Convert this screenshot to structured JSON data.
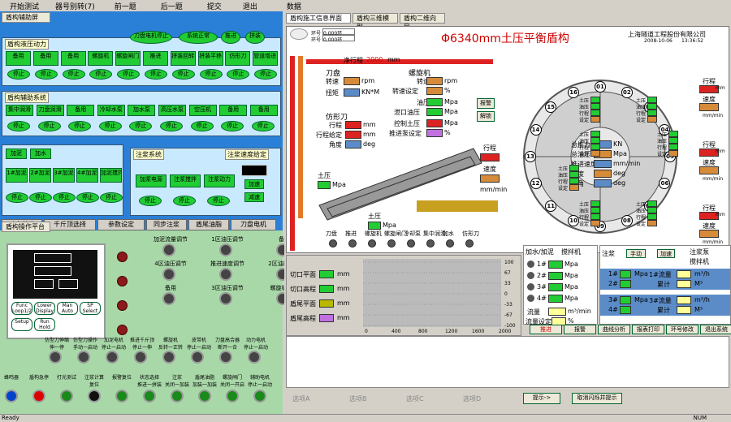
{
  "menu": [
    "开始测试",
    "器号别转(7)",
    "前一题",
    "后一题",
    "提交",
    "退出",
    "数据"
  ],
  "left": {
    "tab": "盾构辅助屏",
    "hydro": {
      "title": "盾构液压动力",
      "r1": [
        "备用",
        "备用",
        "备用",
        "螺旋机",
        "螺旋闸门\n高合器",
        "推进",
        "拼装回转",
        "拼装平移",
        "仿形刀",
        "管道增进\n吸引器"
      ],
      "r2": [
        "停止",
        "停止",
        "停止",
        "停止",
        "停止",
        "停止",
        "停止",
        "停止",
        "停止",
        "停止"
      ],
      "top": [
        "刀盘电机停止",
        "系统正常",
        "推进",
        "拼装"
      ]
    },
    "aux": {
      "title": "盾构辅助系统",
      "r1": [
        "集中润滑",
        "刀盘润滑",
        "备用",
        "冷却水泵",
        "加水泵",
        "高压水泵",
        "空压机",
        "备用",
        "备用"
      ],
      "r2": [
        "停止",
        "停止",
        "停止",
        "停止",
        "停止",
        "停止",
        "停止",
        "停止",
        "停止"
      ]
    },
    "mud": {
      "r0": [
        "加泥",
        "加水"
      ],
      "r1": [
        "1#加泥",
        "2#加泥",
        "3#加泥",
        "4#加泥\n加水",
        "加泥搅拌"
      ],
      "r2": [
        "停止",
        "停止",
        "停止",
        "停止",
        "停止"
      ]
    },
    "grout": {
      "title": "注浆系统",
      "r1": [
        "加浆电源",
        "注浆搅拌",
        "注浆动力"
      ],
      "r2": [
        "停止",
        "停止",
        "停止"
      ],
      "rate_title": "注浆速度给定",
      "up": "加速",
      "down": "减速"
    },
    "bottom": [
      "动力单元",
      "千斤顶选择",
      "参数设定",
      "同步注浆",
      "盾尾油脂",
      "刀盘电机"
    ]
  },
  "ops": {
    "tab": "盾构操作平台",
    "keys": [
      "Func\nLoop1/2",
      "Lower\nDisplay",
      "Man\nAuto",
      "SP\nSelect",
      "Setup",
      "Run\nHold"
    ],
    "knobs": [
      "加泥流量调节",
      "1区油压调节",
      "备用",
      "4区油压调节",
      "推进速度调节",
      "2区油压调节",
      "备用",
      "3区油压调节",
      "螺旋机转速"
    ],
    "row1": [
      "仿型刀伸缩\n伸一停",
      "仿型刀操作\n手动一启动",
      "加泥电机\n停止一启动",
      "推进千斤顶\n停止一伸",
      "螺旋机\n反转一正转",
      "皮带机\n停止一启动",
      "刀盘高合器\n断开一合",
      "动力电机\n停止一启动"
    ],
    "row2": [
      "蜂鸣器",
      "盾构急停",
      "打光测试",
      "注浆计算\n复位",
      "报警复位",
      "状态选择\n推进一拼装",
      "注浆\n关闭一加装",
      "盾尾油脂\n加装一加装",
      "螺旋闸门\n关闭一开启",
      "辅助电机\n停止一启动"
    ]
  },
  "right": {
    "tabs": [
      "盾构施工信息界面",
      "盾构三维模型",
      "盾构二维向导"
    ],
    "title": "Φ6340mm土压平衡盾构",
    "company": "上海隧道工程股份有限公司",
    "date": "2008-10-06",
    "time": "13:36:52",
    "ring": "0.000环",
    "ring2": "0.000环",
    "ringlbl1": "环号",
    "ringlbl2": "环号",
    "stroke": {
      "label": "净行程",
      "val": "2000",
      "unit": "mm"
    },
    "cutter": {
      "title": "刀盘",
      "speed": "转速",
      "torque": "扭矩",
      "u1": "rpm",
      "u2": "KN*M"
    },
    "screw": {
      "title": "螺旋机",
      "speed": "转速",
      "set": "转速设定",
      "u1": "rpm",
      "u2": "%",
      "oil": "油压",
      "gate": "泄口油压",
      "u3": "Mpa",
      "u4": "Mpa",
      "soil": "控制土压",
      "pump": "推进泵设定",
      "u5": "Mpa",
      "u6": "%"
    },
    "copy": {
      "title": "仿形刀",
      "stroke": "行程",
      "given": "行程给定",
      "angle": "角度",
      "u1": "mm",
      "u2": "mm",
      "u3": "deg"
    },
    "soil1": "土压",
    "soil2": "土压",
    "mpa": "Mpa",
    "strokeR": {
      "t": "行程",
      "s": "速度",
      "u": "mm/min"
    },
    "alarm": "报警",
    "release": "解锁",
    "center": [
      "总推力",
      "总油压",
      "推进速度",
      "坡度",
      "转角"
    ],
    "cunit": [
      "KN",
      "Mpa",
      "mm/min",
      "deg",
      "deg"
    ],
    "zone": [
      "土压",
      "油压",
      "行程",
      "设定"
    ],
    "zunit": [
      "Mpa",
      "Mpa",
      "mm",
      "%"
    ],
    "nums": [
      "01",
      "02",
      "03",
      "04",
      "05",
      "06",
      "07",
      "08",
      "09",
      "10",
      "11",
      "12",
      "13",
      "14",
      "15",
      "16"
    ],
    "rside": [
      "行程",
      "速度",
      "行程",
      "速度",
      "行程",
      "速度"
    ],
    "runit": [
      "mm",
      "mm/min",
      "mm",
      "mm/min",
      "mm",
      "mm/min"
    ],
    "legend": [
      "刀盘",
      "推进",
      "螺旋机",
      "螺旋闸门",
      "冷却泵",
      "集中润滑",
      "加水",
      "仿形刀"
    ],
    "cut": [
      {
        "l": "切口平面",
        "u": "mm"
      },
      {
        "l": "切口高程",
        "u": "mm"
      },
      {
        "l": "盾尾平面",
        "u": "mm"
      },
      {
        "l": "盾尾高程",
        "u": "mm"
      }
    ],
    "chart": {
      "yr": [
        "100",
        "67",
        "33",
        "0",
        "-33",
        "-67",
        "-100"
      ],
      "x": [
        "0",
        "400",
        "800",
        "1200",
        "1600",
        "2000"
      ]
    },
    "water": {
      "title": "加水/加泥",
      "stir": "搅拌机",
      "rows": [
        "1#",
        "2#",
        "3#",
        "4#"
      ],
      "u": "Mpa",
      "flow": "流量",
      "flowset": "流量设定",
      "fu": "m³/min",
      "fu2": "%"
    },
    "grout": {
      "title": "注浆",
      "manual": "手动",
      "accel": "加速",
      "pump": "注浆泵",
      "stir": "搅拌机",
      "rows": [
        {
          "a": "1#",
          "b": "2#",
          "u": "Mpa",
          "f": "1#流量",
          "s": "累计",
          "fu": "m³/h",
          "su": "M³"
        },
        {
          "a": "3#",
          "b": "4#",
          "u": "Mpa",
          "f": "3#流量",
          "s": "累计",
          "fu": "m³/h",
          "su": "M³"
        }
      ]
    },
    "btns": [
      "推进",
      "报警",
      "曲线分析",
      "报表打印",
      "环号修改",
      "退出系统"
    ],
    "radios": [
      "选项A",
      "选项B",
      "选项C",
      "选项D"
    ],
    "hint": "提示->",
    "cancel": "取消闪烁并提示"
  },
  "status": {
    "left": "Ready",
    "right": "NUM"
  }
}
